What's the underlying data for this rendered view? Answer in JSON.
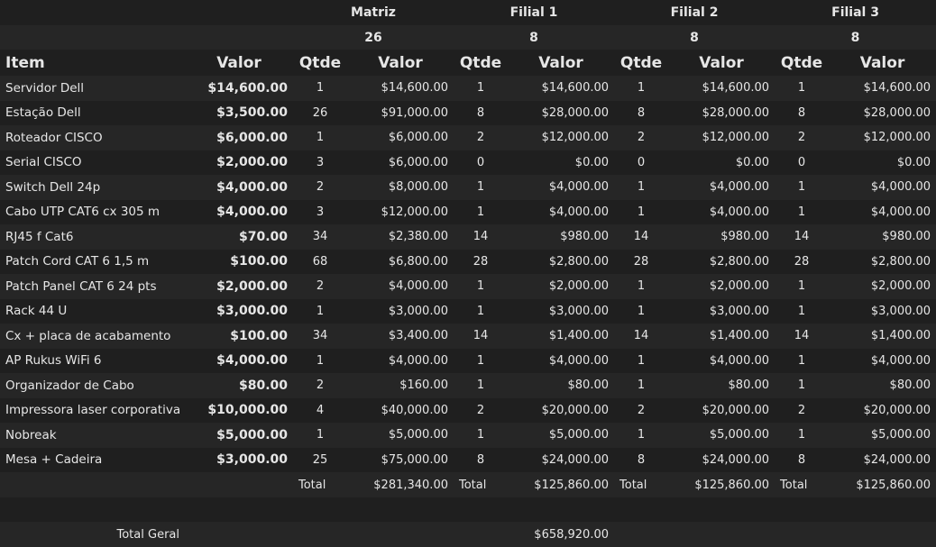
{
  "branches": [
    {
      "name": "Matriz",
      "count": "26"
    },
    {
      "name": "Filial 1",
      "count": "8"
    },
    {
      "name": "Filial 2",
      "count": "8"
    },
    {
      "name": "Filial 3",
      "count": "8"
    }
  ],
  "headers": {
    "item": "Item",
    "valor": "Valor",
    "qtde": "Qtde"
  },
  "rows": [
    {
      "item": "Servidor Dell",
      "price": "$14,600.00",
      "b": [
        [
          "1",
          "$14,600.00"
        ],
        [
          "1",
          "$14,600.00"
        ],
        [
          "1",
          "$14,600.00"
        ],
        [
          "1",
          "$14,600.00"
        ]
      ]
    },
    {
      "item": "Estação Dell",
      "price": "$3,500.00",
      "b": [
        [
          "26",
          "$91,000.00"
        ],
        [
          "8",
          "$28,000.00"
        ],
        [
          "8",
          "$28,000.00"
        ],
        [
          "8",
          "$28,000.00"
        ]
      ]
    },
    {
      "item": "Roteador CISCO",
      "price": "$6,000.00",
      "b": [
        [
          "1",
          "$6,000.00"
        ],
        [
          "2",
          "$12,000.00"
        ],
        [
          "2",
          "$12,000.00"
        ],
        [
          "2",
          "$12,000.00"
        ]
      ]
    },
    {
      "item": "Serial CISCO",
      "price": "$2,000.00",
      "b": [
        [
          "3",
          "$6,000.00"
        ],
        [
          "0",
          "$0.00"
        ],
        [
          "0",
          "$0.00"
        ],
        [
          "0",
          "$0.00"
        ]
      ]
    },
    {
      "item": "Switch Dell 24p",
      "price": "$4,000.00",
      "b": [
        [
          "2",
          "$8,000.00"
        ],
        [
          "1",
          "$4,000.00"
        ],
        [
          "1",
          "$4,000.00"
        ],
        [
          "1",
          "$4,000.00"
        ]
      ]
    },
    {
      "item": "Cabo UTP CAT6 cx 305 m",
      "price": "$4,000.00",
      "b": [
        [
          "3",
          "$12,000.00"
        ],
        [
          "1",
          "$4,000.00"
        ],
        [
          "1",
          "$4,000.00"
        ],
        [
          "1",
          "$4,000.00"
        ]
      ]
    },
    {
      "item": "RJ45 f Cat6",
      "price": "$70.00",
      "b": [
        [
          "34",
          "$2,380.00"
        ],
        [
          "14",
          "$980.00"
        ],
        [
          "14",
          "$980.00"
        ],
        [
          "14",
          "$980.00"
        ]
      ]
    },
    {
      "item": "Patch Cord CAT 6 1,5 m",
      "price": "$100.00",
      "b": [
        [
          "68",
          "$6,800.00"
        ],
        [
          "28",
          "$2,800.00"
        ],
        [
          "28",
          "$2,800.00"
        ],
        [
          "28",
          "$2,800.00"
        ]
      ]
    },
    {
      "item": "Patch Panel CAT 6 24 pts",
      "price": "$2,000.00",
      "b": [
        [
          "2",
          "$4,000.00"
        ],
        [
          "1",
          "$2,000.00"
        ],
        [
          "1",
          "$2,000.00"
        ],
        [
          "1",
          "$2,000.00"
        ]
      ]
    },
    {
      "item": "Rack 44 U",
      "price": "$3,000.00",
      "b": [
        [
          "1",
          "$3,000.00"
        ],
        [
          "1",
          "$3,000.00"
        ],
        [
          "1",
          "$3,000.00"
        ],
        [
          "1",
          "$3,000.00"
        ]
      ]
    },
    {
      "item": "Cx + placa de acabamento",
      "price": "$100.00",
      "b": [
        [
          "34",
          "$3,400.00"
        ],
        [
          "14",
          "$1,400.00"
        ],
        [
          "14",
          "$1,400.00"
        ],
        [
          "14",
          "$1,400.00"
        ]
      ]
    },
    {
      "item": "AP Rukus WiFi 6",
      "price": "$4,000.00",
      "b": [
        [
          "1",
          "$4,000.00"
        ],
        [
          "1",
          "$4,000.00"
        ],
        [
          "1",
          "$4,000.00"
        ],
        [
          "1",
          "$4,000.00"
        ]
      ]
    },
    {
      "item": "Organizador de Cabo",
      "price": "$80.00",
      "b": [
        [
          "2",
          "$160.00"
        ],
        [
          "1",
          "$80.00"
        ],
        [
          "1",
          "$80.00"
        ],
        [
          "1",
          "$80.00"
        ]
      ]
    },
    {
      "item": "Impressora laser corporativa",
      "price": "$10,000.00",
      "b": [
        [
          "4",
          "$40,000.00"
        ],
        [
          "2",
          "$20,000.00"
        ],
        [
          "2",
          "$20,000.00"
        ],
        [
          "2",
          "$20,000.00"
        ]
      ]
    },
    {
      "item": "Nobreak",
      "price": "$5,000.00",
      "b": [
        [
          "1",
          "$5,000.00"
        ],
        [
          "1",
          "$5,000.00"
        ],
        [
          "1",
          "$5,000.00"
        ],
        [
          "1",
          "$5,000.00"
        ]
      ]
    },
    {
      "item": "Mesa + Cadeira",
      "price": "$3,000.00",
      "b": [
        [
          "25",
          "$75,000.00"
        ],
        [
          "8",
          "$24,000.00"
        ],
        [
          "8",
          "$24,000.00"
        ],
        [
          "8",
          "$24,000.00"
        ]
      ]
    }
  ],
  "totals": {
    "label": "Total",
    "values": [
      "$281,340.00",
      "$125,860.00",
      "$125,860.00",
      "$125,860.00"
    ]
  },
  "grand_total": {
    "label": "Total Geral",
    "value": "$658,920.00"
  }
}
